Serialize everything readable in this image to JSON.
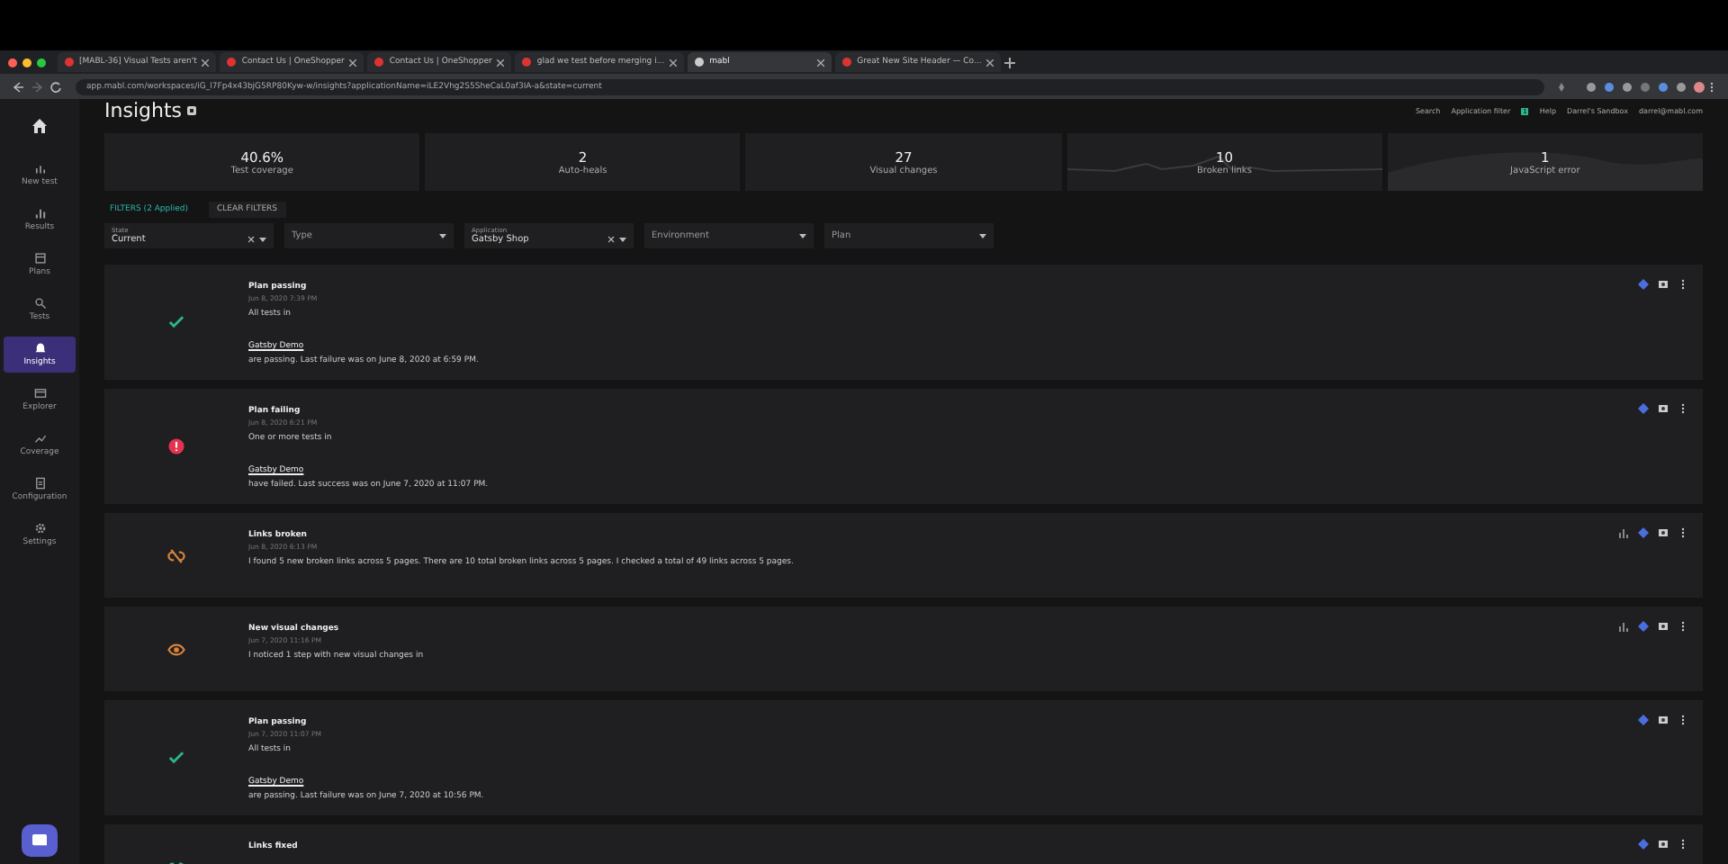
{
  "browser": {
    "tabs": [
      {
        "title": "[MABL-36] Visual Tests aren't",
        "selected": false
      },
      {
        "title": "Contact Us | OneShopper",
        "selected": false
      },
      {
        "title": "Contact Us | OneShopper",
        "selected": false
      },
      {
        "title": "glad we test before merging i...",
        "selected": false
      },
      {
        "title": "mabl",
        "selected": true
      },
      {
        "title": "Great New Site Header — Co...",
        "selected": false
      }
    ],
    "url": "app.mabl.com/workspaces/iG_l7Fp4x43bjG5RP80Kyw-w/insights?applicationName=iLE2Vhg2S5SheCaL0af3IA-a&state=current"
  },
  "sidebar": {
    "items": [
      {
        "label": "New test",
        "selected": false
      },
      {
        "label": "Results",
        "selected": false
      },
      {
        "label": "Plans",
        "selected": false
      },
      {
        "label": "Tests",
        "selected": false
      },
      {
        "label": "Insights",
        "selected": true
      },
      {
        "label": "Explorer",
        "selected": false
      },
      {
        "label": "Coverage",
        "selected": false
      },
      {
        "label": "Configuration",
        "selected": false
      },
      {
        "label": "Settings",
        "selected": false
      }
    ]
  },
  "page": {
    "title": "Insights"
  },
  "header_menu": {
    "search": "Search",
    "app_filter": "Application filter",
    "app_filter_count": "1",
    "help": "Help",
    "workspace": "Darrel's Sandbox",
    "user": "darrel@mabl.com"
  },
  "stats": [
    {
      "kind": "plain",
      "value": "40.6%",
      "label": "Test coverage"
    },
    {
      "kind": "plain",
      "value": "2",
      "label": "Auto-heals"
    },
    {
      "kind": "plain",
      "value": "27",
      "label": "Visual changes"
    },
    {
      "kind": "spark",
      "value": "10",
      "label": "Broken links"
    },
    {
      "kind": "area",
      "value": "1",
      "label": "JavaScript error"
    }
  ],
  "filters": {
    "toggle": "FILTERS (2 Applied)",
    "clear": "CLEAR FILTERS",
    "fields": [
      {
        "label": "State",
        "value": "Current",
        "clearable": true
      },
      {
        "placeholder": "Type",
        "clearable": false
      },
      {
        "label": "Application",
        "value": "Gatsby Shop",
        "clearable": true
      },
      {
        "placeholder": "Environment",
        "clearable": false
      },
      {
        "placeholder": "Plan",
        "clearable": false
      }
    ]
  },
  "insights": [
    {
      "kind": "pass",
      "title": "Plan passing",
      "time": "Jun 8, 2020 7:39 PM",
      "prefix": "All tests in",
      "link": "Gatsby Demo",
      "suffix": "are passing. Last failure was on June 8, 2020 at 6:59 PM."
    },
    {
      "kind": "fail",
      "title": "Plan failing",
      "time": "Jun 8, 2020 6:21 PM",
      "prefix": "One or more tests in",
      "link": "Gatsby Demo",
      "suffix": "have failed. Last success was on June 7, 2020 at 11:07 PM."
    },
    {
      "kind": "links_broken",
      "title": "Links broken",
      "time": "Jun 8, 2020 6:13 PM",
      "prefix": "I found 5 new broken links across 5 pages. There are 10 total broken links across 5 pages. I checked a total of 49 links across 5 pages."
    },
    {
      "kind": "visual",
      "title": "New visual changes",
      "time": "Jun 7, 2020 11:16 PM",
      "prefix": "I noticed 1 step with new visual changes in"
    },
    {
      "kind": "pass",
      "title": "Plan passing",
      "time": "Jun 7, 2020 11:07 PM",
      "prefix": "All tests in",
      "link": "Gatsby Demo",
      "suffix": "are passing. Last failure was on June 7, 2020 at 10:56 PM."
    },
    {
      "kind": "links_fixed",
      "title": "Links fixed"
    }
  ]
}
